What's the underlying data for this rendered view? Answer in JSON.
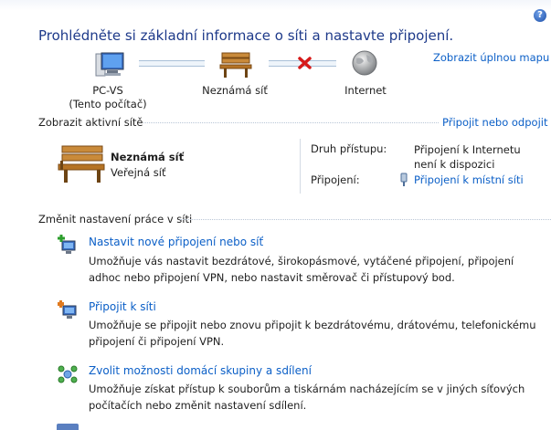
{
  "help_icon": "?",
  "title": "Prohlédněte si základní informace o síti a nastavte připojení.",
  "map": {
    "full_map_link": "Zobrazit úplnou mapu",
    "computer_name": "PC-VS",
    "computer_sub": "(Tento počítač)",
    "network_label": "Neznámá síť",
    "internet_label": "Internet"
  },
  "active": {
    "heading": "Zobrazit aktivní sítě",
    "connect_link": "Připojit nebo odpojit",
    "network_name": "Neznámá síť",
    "network_type": "Veřejná síť",
    "access_label": "Druh přístupu:",
    "access_value": "Připojení k Internetu není k dispozici",
    "connections_label": "Připojení:",
    "connections_value": "Připojení k místní síti"
  },
  "change": {
    "heading": "Změnit nastavení práce v síti",
    "tasks": [
      {
        "title": "Nastavit nové připojení nebo síť",
        "desc": "Umožňuje vás nastavit bezdrátové, širokopásmové, vytáčené připojení, připojení adhoc nebo připojení VPN, nebo nastavit směrovač či přístupový bod."
      },
      {
        "title": "Připojit k síti",
        "desc": "Umožňuje se připojit nebo znovu připojit k bezdrátovému, drátovému, telefonickému připojení či připojení VPN."
      },
      {
        "title": "Zvolit možnosti domácí skupiny a sdílení",
        "desc": "Umožňuje získat přístup k souborům a tiskárnám nacházejícím se v jiných síťových počítačích nebo změnit nastavení sdílení."
      }
    ]
  },
  "colors": {
    "title": "#1e3a8a",
    "link": "#0b5fc7",
    "error_x": "#d61a1a"
  }
}
